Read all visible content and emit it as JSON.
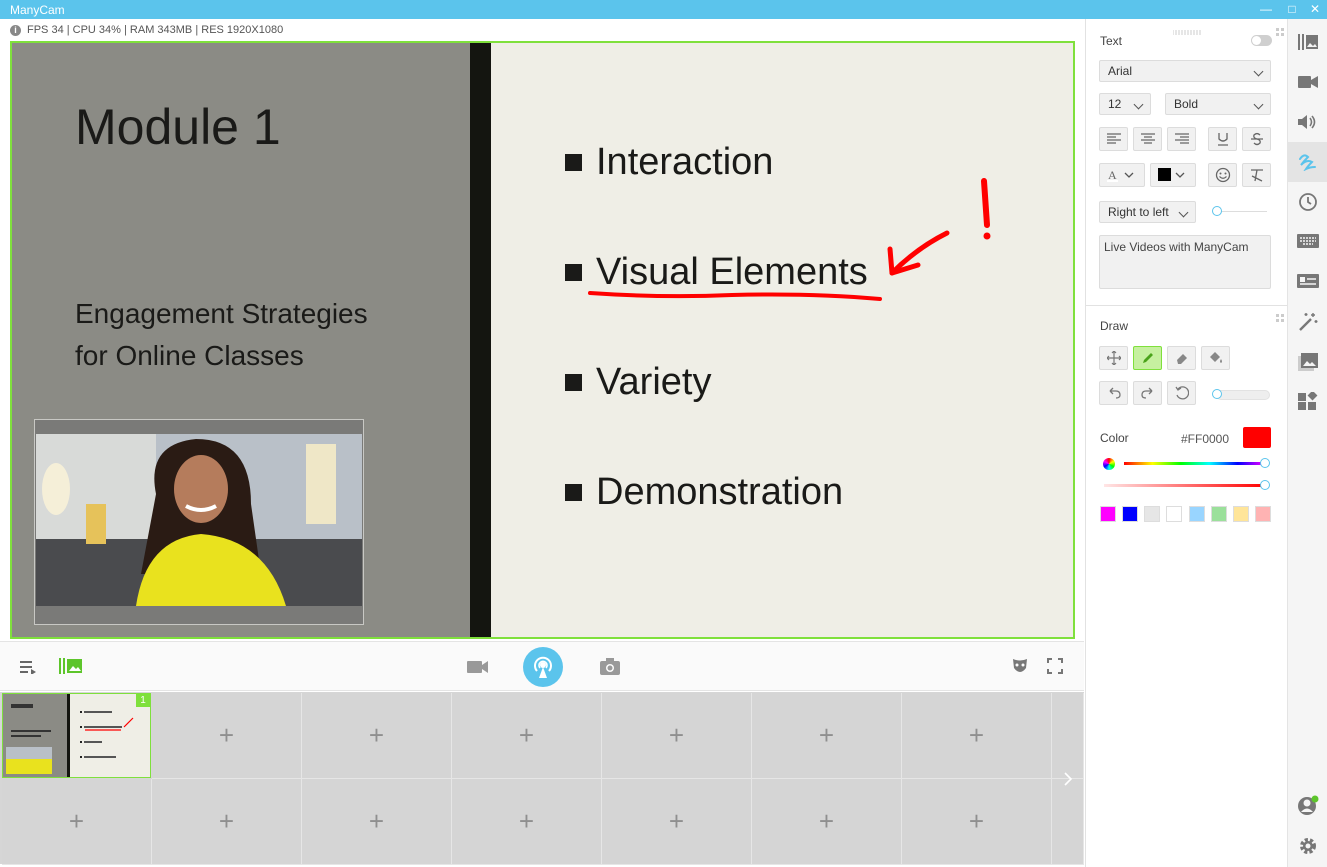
{
  "window": {
    "title": "ManyCam",
    "minimize": "—",
    "maximize": "□",
    "close": "✕"
  },
  "stats": {
    "text": "FPS 34 | CPU 34% | RAM 343MB | RES 1920X1080"
  },
  "slide": {
    "title": "Module 1",
    "subtitle_line1": "Engagement Strategies",
    "subtitle_line2": "for Online Classes",
    "bullets": [
      "Interaction",
      "Visual Elements",
      "Variety",
      "Demonstration"
    ],
    "annotation_color": "#FF0000"
  },
  "scenes": {
    "active_badge": "1",
    "add_symbol": "+"
  },
  "text_panel": {
    "label": "Text",
    "font": "Arial",
    "size": "12",
    "weight": "Bold",
    "direction": "Right to left",
    "content": "Live Videos with ManyCam",
    "text_color": "#000000"
  },
  "draw_panel": {
    "label": "Draw",
    "color_label": "Color",
    "color_hex": "#FF0000",
    "swatches": [
      "#FF00FF",
      "#0000FF",
      "#E6E6E6",
      "#FFFFFF",
      "#99D5FF",
      "#9BE09B",
      "#FFE599",
      "#FFB3B3"
    ]
  },
  "colors": {
    "accent": "#5BC4EC",
    "green": "#7FE03C",
    "active_tool": "#C6F0A0"
  },
  "sidebar_icons": [
    "presets-icon",
    "video-icon",
    "audio-icon",
    "draw-icon",
    "history-icon",
    "keyboard-icon",
    "lower-thirds-icon",
    "effects-icon",
    "images-icon",
    "widgets-icon",
    "account-icon",
    "settings-icon"
  ]
}
